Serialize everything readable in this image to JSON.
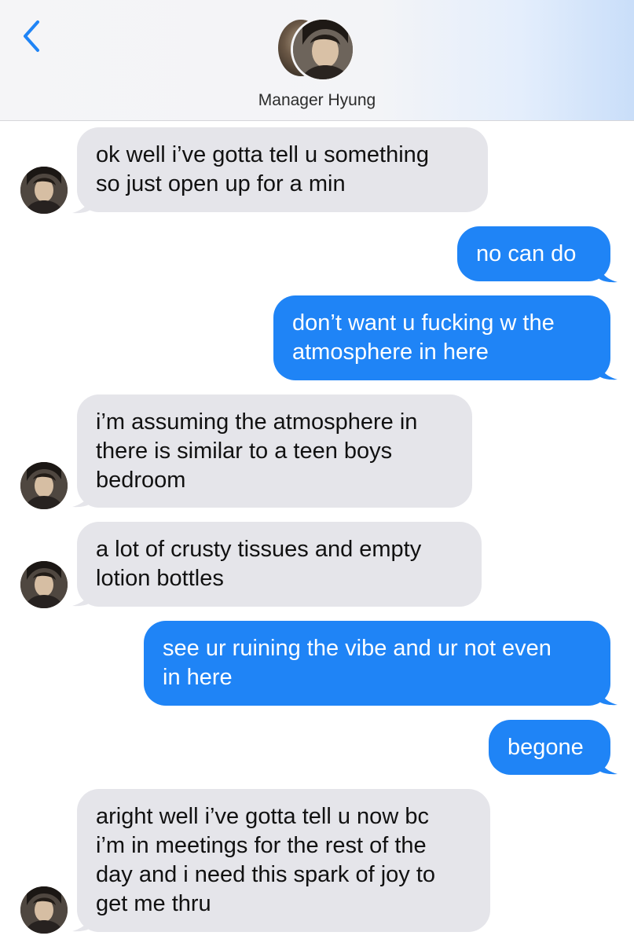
{
  "header": {
    "contact_name": "Manager Hyung"
  },
  "colors": {
    "incoming_bubble": "#e5e5ea",
    "outgoing_bubble": "#1f84f6",
    "back_chevron": "#1f84f6"
  },
  "icons": {
    "back": "chevron-left-icon"
  },
  "messages": [
    {
      "direction": "incoming",
      "text": "ok well i’ve gotta tell u something\nso just open up for a min"
    },
    {
      "direction": "outgoing",
      "text": "no can do"
    },
    {
      "direction": "outgoing",
      "text": "don’t want u fucking w the\natmosphere in here"
    },
    {
      "direction": "incoming",
      "text": "i’m assuming the atmosphere in\nthere is similar to a teen boys\nbedroom"
    },
    {
      "direction": "incoming",
      "text": "a lot of crusty tissues and empty\nlotion bottles"
    },
    {
      "direction": "outgoing",
      "text": "see ur ruining the vibe and ur not even\nin here"
    },
    {
      "direction": "outgoing",
      "text": "begone"
    },
    {
      "direction": "incoming",
      "text": "aright well i’ve gotta tell u now bc\ni’m in meetings for the rest of the\nday and i need this spark of joy to\nget me thru"
    }
  ]
}
